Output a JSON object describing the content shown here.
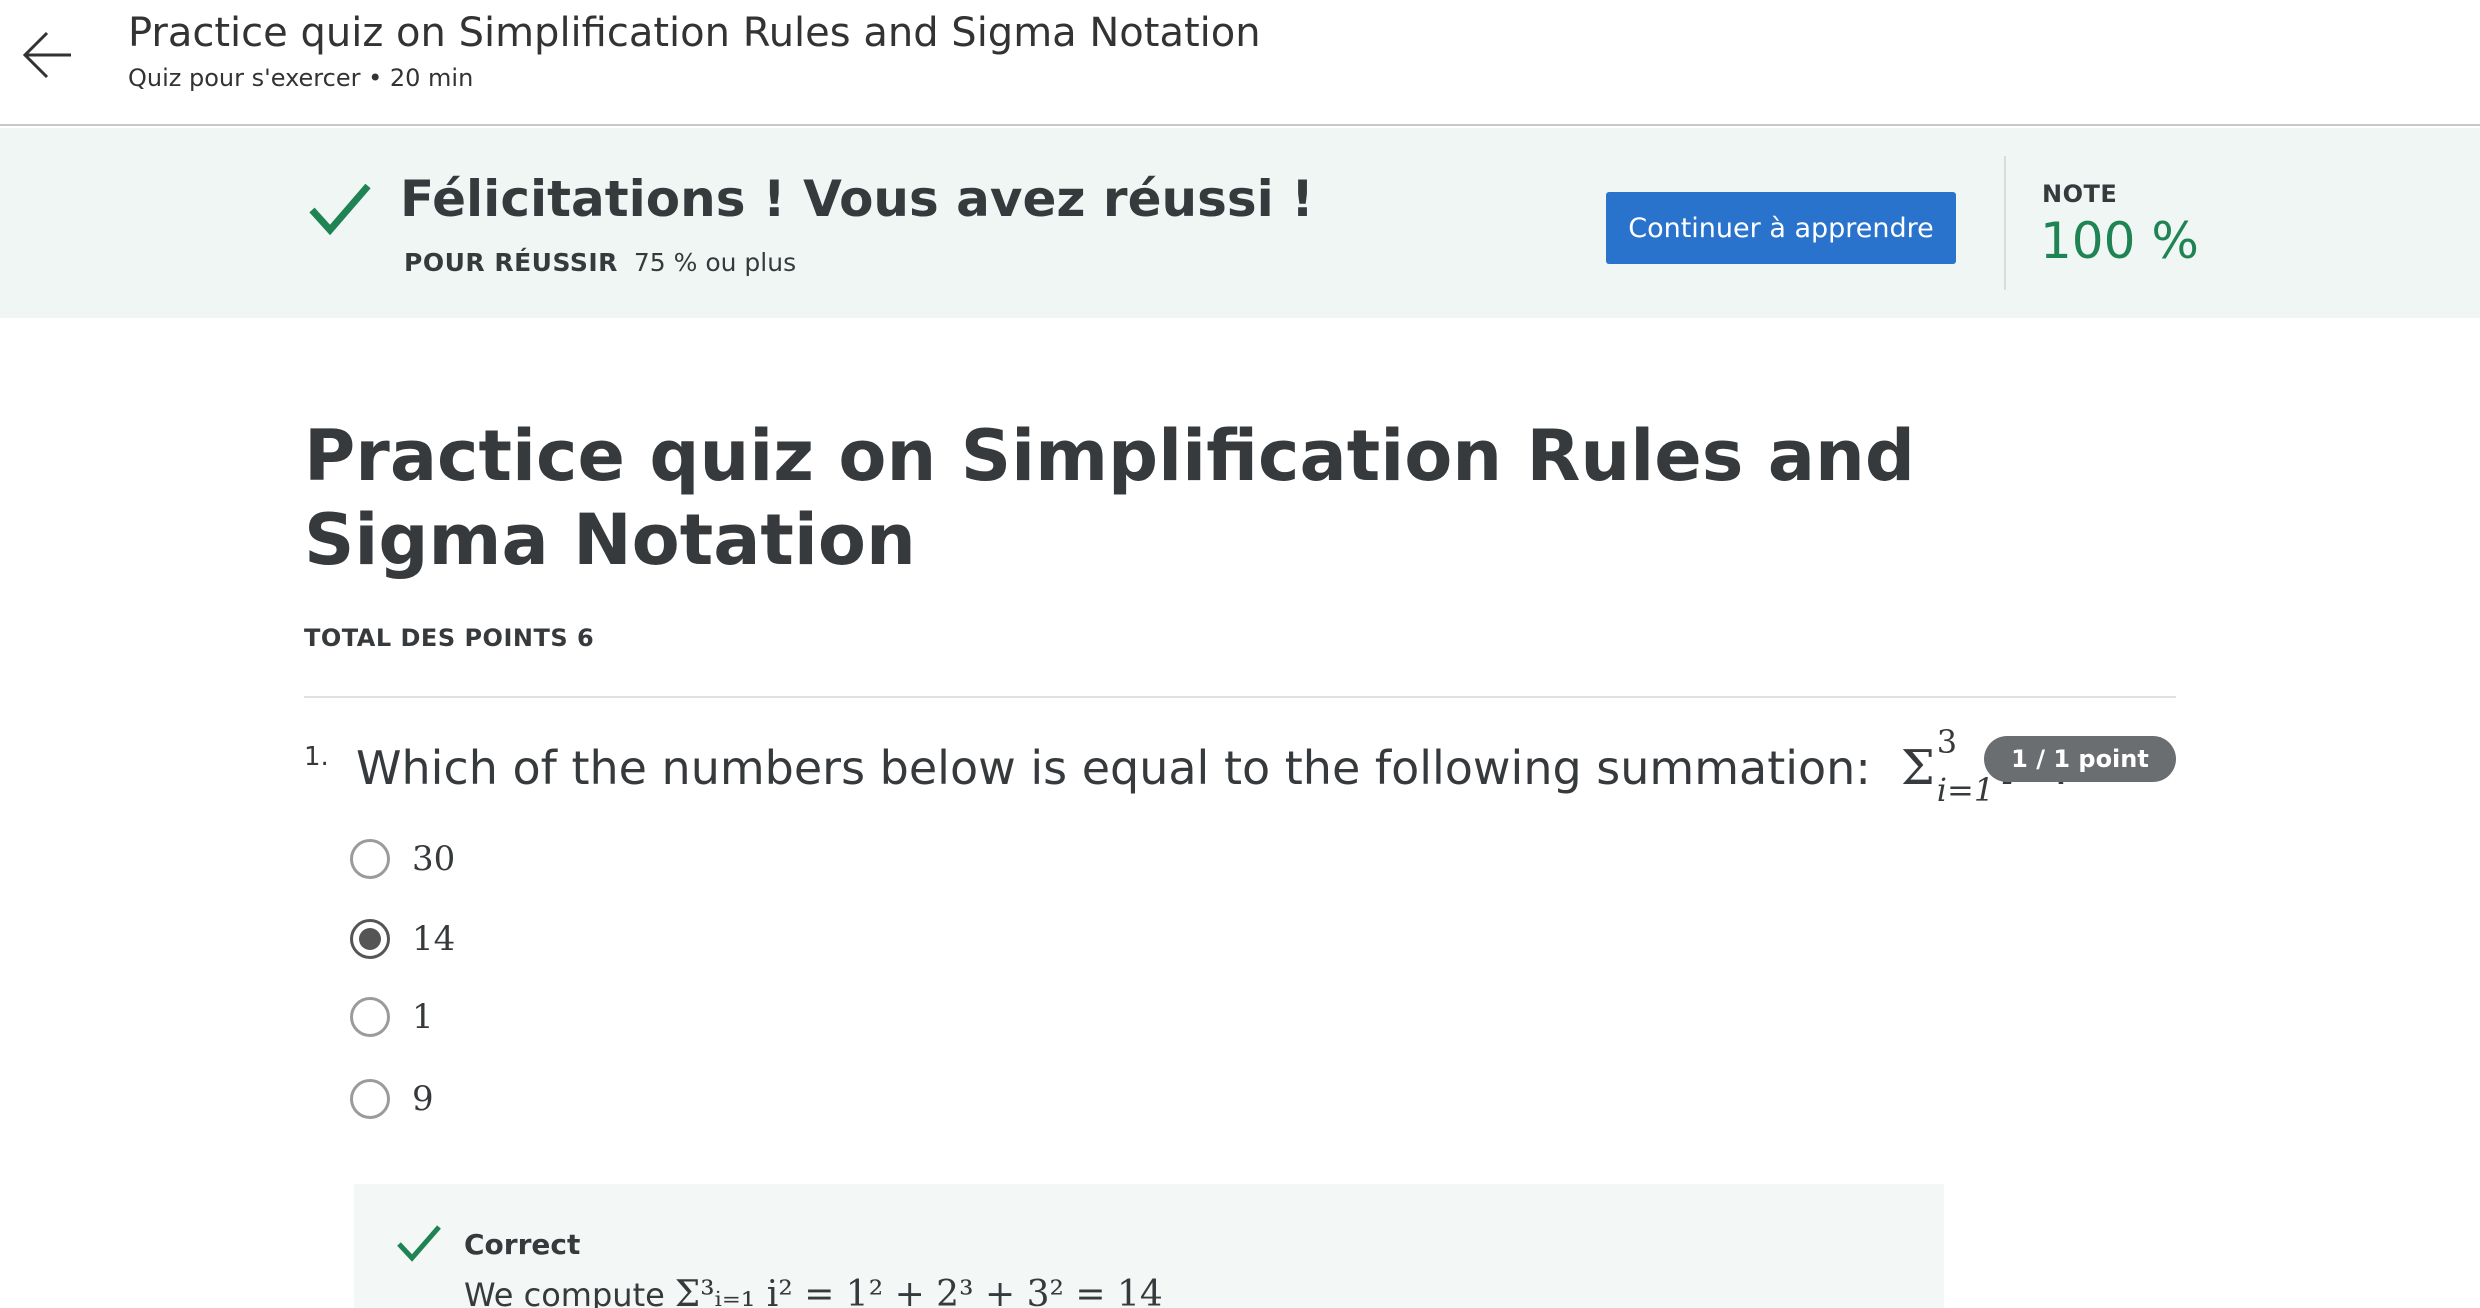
{
  "header": {
    "title": "Practice quiz on Simplification Rules and Sigma Notation",
    "subtitle": "Quiz pour s'exercer • 20 min"
  },
  "banner": {
    "title": "Félicitations ! Vous avez réussi !",
    "pass_label": "POUR RÉUSSIR",
    "pass_value": "75 % ou plus",
    "continue_label": "Continuer à apprendre",
    "grade_label": "NOTE",
    "grade_value": "100 %",
    "accent_color": "#1f8354",
    "button_color": "#2a73cc"
  },
  "main": {
    "title": "Practice quiz on Simplification Rules and Sigma Notation",
    "total_points": "TOTAL DES POINTS 6"
  },
  "question": {
    "number": "1.",
    "text": "Which of the numbers below is equal to the following summation:",
    "math": {
      "sigma": "Σ",
      "upper": "3",
      "lower": "i=1",
      "var": "i",
      "power": "2",
      "end": "?"
    },
    "points": "1 / 1 point",
    "options": [
      {
        "label": "30",
        "selected": false
      },
      {
        "label": "14",
        "selected": true
      },
      {
        "label": "1",
        "selected": false
      },
      {
        "label": "9",
        "selected": false
      }
    ]
  },
  "feedback": {
    "status": "Correct",
    "text_start": "We compute",
    "math": "Σ³ᵢ₌₁ i² = 1² + 2³ + 3² = 14"
  }
}
